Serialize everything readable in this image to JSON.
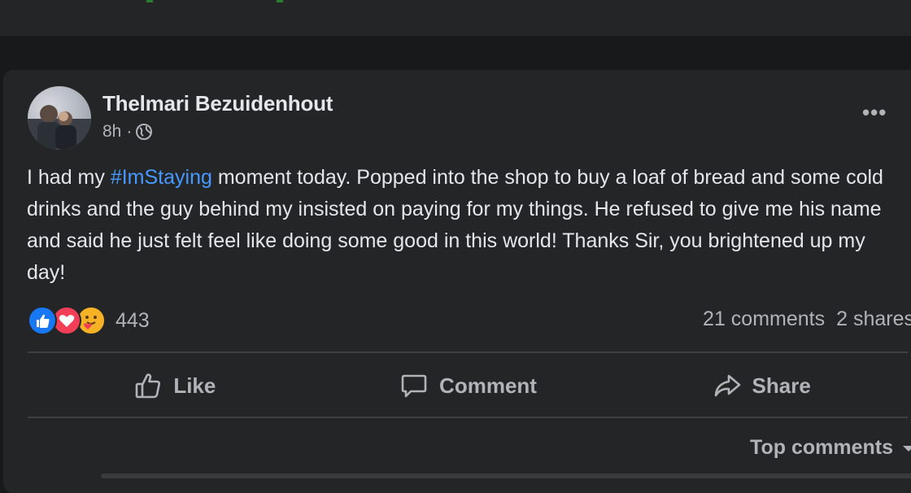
{
  "post": {
    "author": "Thelmari Bezuidenhout",
    "time": "8h",
    "separator": "·",
    "privacy_icon": "globe-icon",
    "more_label": "•••",
    "text": {
      "before": "I had my ",
      "hashtag": "#ImStaying",
      "after": " moment today. Popped into the shop to buy a loaf of bread and some cold drinks and the guy behind my insisted on  paying for my things. He refused to give me his name and said he just felt feel like doing some good in this world! Thanks Sir, you brightened up my day!"
    },
    "reactions": {
      "icons": [
        "like-reaction-icon",
        "love-reaction-icon",
        "care-reaction-icon"
      ],
      "count": "443"
    },
    "comments_count": "21 comments",
    "shares_count": "2 shares"
  },
  "actions": {
    "like": "Like",
    "comment": "Comment",
    "share": "Share"
  },
  "comments": {
    "sort_label": "Top comments"
  },
  "colors": {
    "background": "#18191a",
    "card": "#242526",
    "text_primary": "#e4e6eb",
    "text_secondary": "#b0b3b8",
    "link": "#4599ff",
    "like": "#1877f2",
    "love": "#f33e58",
    "care": "#f7b125"
  }
}
